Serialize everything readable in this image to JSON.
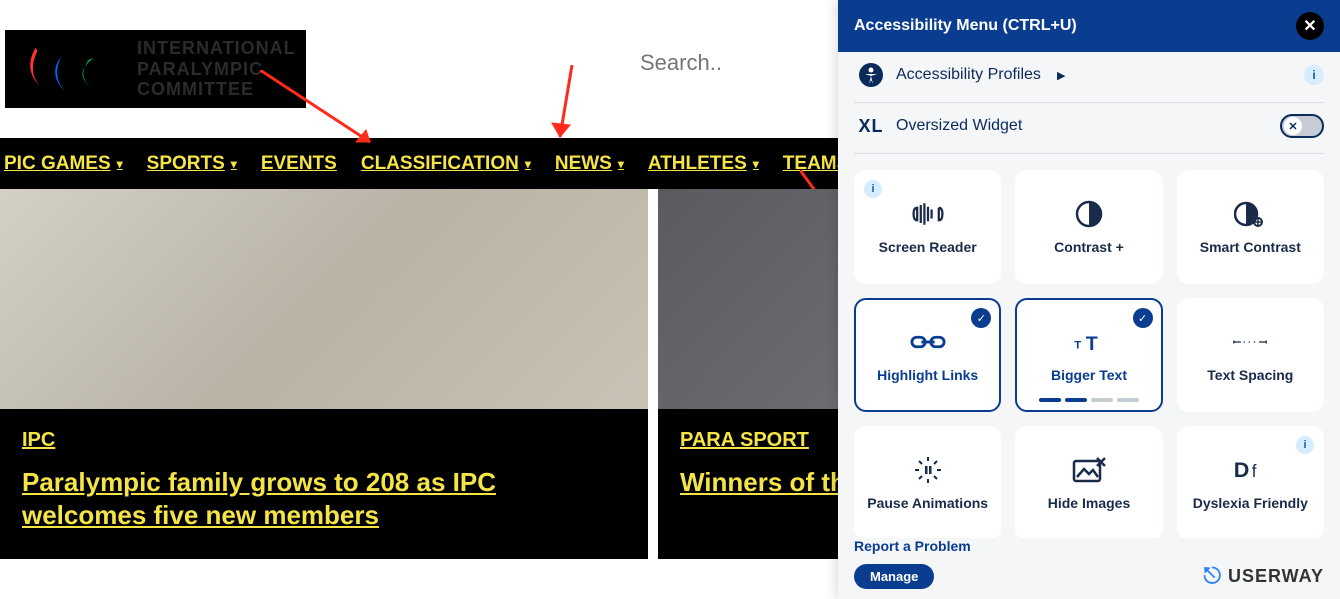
{
  "header": {
    "logo_text_l1": "INTERNATIONAL",
    "logo_text_l2": "PARALYMPIC",
    "logo_text_l3": "COMMITTEE",
    "search_placeholder": "Search.."
  },
  "nav": {
    "items": [
      {
        "label": "PIC GAMES",
        "has_chev": true
      },
      {
        "label": "SPORTS",
        "has_chev": true
      },
      {
        "label": "EVENTS",
        "has_chev": false
      },
      {
        "label": "CLASSIFICATION",
        "has_chev": true
      },
      {
        "label": "NEWS",
        "has_chev": true
      },
      {
        "label": "ATHLETES",
        "has_chev": true
      },
      {
        "label": "TEAMS/NP",
        "has_chev": false
      }
    ]
  },
  "cards": [
    {
      "tag": "IPC",
      "title": "Paralympic family grows to 208 as IPC welcomes five new members"
    },
    {
      "tag": "PARA SPORT",
      "title": "Winners of the announced"
    }
  ],
  "acc": {
    "title": "Accessibility Menu (CTRL+U)",
    "profiles_label": "Accessibility Profiles",
    "oversized_label": "Oversized Widget",
    "tiles": [
      {
        "label": "Screen Reader",
        "icon": "screen-reader",
        "active": false,
        "info_left": true
      },
      {
        "label": "Contrast +",
        "icon": "contrast",
        "active": false
      },
      {
        "label": "Smart Contrast",
        "icon": "smart-contrast",
        "active": false
      },
      {
        "label": "Highlight Links",
        "icon": "highlight-links",
        "active": true,
        "check": true
      },
      {
        "label": "Bigger Text",
        "icon": "bigger-text",
        "active": true,
        "check": true,
        "steps": [
          true,
          true,
          false,
          false
        ]
      },
      {
        "label": "Text Spacing",
        "icon": "text-spacing",
        "active": false
      },
      {
        "label": "Pause Animations",
        "icon": "pause-anim",
        "active": false
      },
      {
        "label": "Hide Images",
        "icon": "hide-images",
        "active": false
      },
      {
        "label": "Dyslexia Friendly",
        "icon": "dyslexia",
        "active": false,
        "info_right": true
      }
    ],
    "report_label": "Report a Problem",
    "manage_label": "Manage",
    "brand": "USERWAY"
  }
}
